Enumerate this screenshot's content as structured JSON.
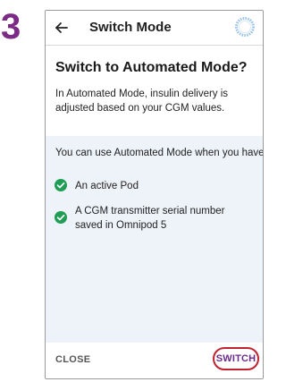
{
  "step": {
    "number": "3"
  },
  "header": {
    "title": "Switch Mode",
    "back_icon": "back-arrow-icon",
    "status_icon": "pod-status-ring-icon"
  },
  "content": {
    "heading": "Switch to Automated Mode?",
    "description": "In Automated Mode, insulin delivery is adjusted based on your CGM values."
  },
  "panel": {
    "intro": "You can use Automated Mode when you have:",
    "items": [
      {
        "text": "An active Pod",
        "icon": "check-circle-icon"
      },
      {
        "text": "A CGM transmitter serial number saved in Omnipod 5",
        "icon": "check-circle-icon"
      }
    ]
  },
  "actions": {
    "close_label": "CLOSE",
    "switch_label": "SWITCH"
  },
  "colors": {
    "step_number": "#7b2b86",
    "check": "#1f9d55",
    "panel_bg": "#eef2f9",
    "switch_text": "#6b2b8a",
    "highlight_ring": "#c0232f"
  }
}
